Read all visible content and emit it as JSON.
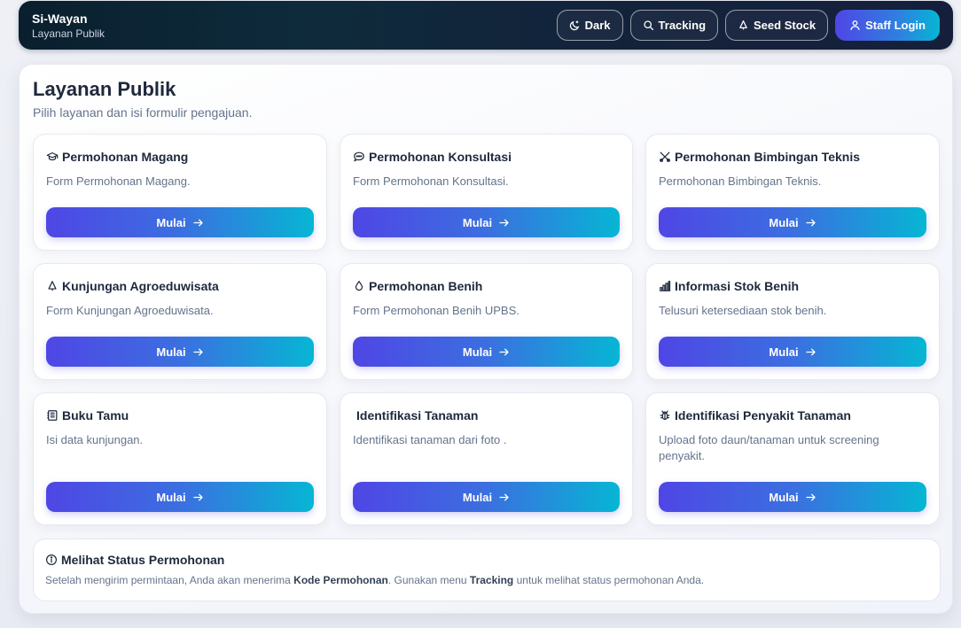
{
  "header": {
    "brand_name": "Si-Wayan",
    "brand_sub": "Layanan Publik",
    "nav": [
      {
        "label": "Dark",
        "icon": "moon-icon"
      },
      {
        "label": "Tracking",
        "icon": "search-icon"
      },
      {
        "label": "Seed Stock",
        "icon": "bell-icon"
      },
      {
        "label": "Staff Login",
        "icon": "user-icon"
      }
    ]
  },
  "main": {
    "title": "Layanan Publik",
    "subtitle": "Pilih layanan dan isi formulir pengajuan.",
    "start_label": "Mulai",
    "cards": [
      {
        "title": "Permohonan Magang",
        "desc": "Form Permohonan Magang.",
        "icon": "graduation-cap-icon"
      },
      {
        "title": "Permohonan Konsultasi",
        "desc": "Form Permohonan Konsultasi.",
        "icon": "chat-bubble-icon"
      },
      {
        "title": "Permohonan Bimbingan Teknis",
        "desc": "Permohonan Bimbingan Teknis.",
        "icon": "tools-icon"
      },
      {
        "title": "Kunjungan Agroeduwisata",
        "desc": "Form Kunjungan Agroeduwisata.",
        "icon": "tree-icon"
      },
      {
        "title": "Permohonan Benih",
        "desc": "Form Permohonan Benih UPBS.",
        "icon": "droplet-icon"
      },
      {
        "title": "Informasi Stok Benih",
        "desc": "Telusuri ketersediaan stok benih.",
        "icon": "bar-chart-icon"
      },
      {
        "title": "Buku Tamu",
        "desc": "Isi data kunjungan.",
        "icon": "notebook-icon"
      },
      {
        "title": "Identifikasi Tanaman",
        "desc": "Identifikasi tanaman dari foto .",
        "icon": ""
      },
      {
        "title": "Identifikasi Penyakit Tanaman",
        "desc": "Upload foto daun/tanaman untuk screening penyakit.",
        "icon": "bug-icon"
      }
    ],
    "info": {
      "title": "Melihat Status Permohonan",
      "text_1": "Setelah mengirim permintaan, Anda akan menerima ",
      "bold_1": "Kode Permohonan",
      "text_2": ". Gunakan menu ",
      "bold_2": "Tracking",
      "text_3": " untuk melihat status permohonan Anda."
    }
  },
  "colors": {
    "header_bg": "#0e2b3b",
    "accent_start": "#4f46e5",
    "accent_end": "#06b6d4",
    "text_dark": "#1e293b",
    "text_muted": "#64748b"
  }
}
